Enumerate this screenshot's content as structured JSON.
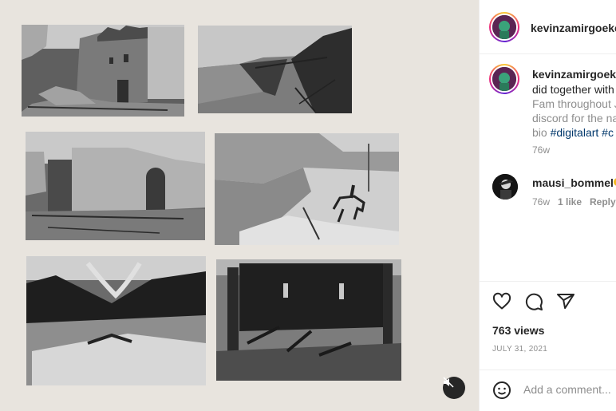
{
  "post": {
    "author": "kevinzamirgoeke",
    "caption_lines": [
      "did together with",
      "Fam throughout J",
      "discord for the na"
    ],
    "caption_last_prefix": "bio ",
    "hashtags": [
      "#digitalart",
      "#c"
    ],
    "caption_age": "76w"
  },
  "comment": {
    "username": "mausi_bommel",
    "age": "76w",
    "likes": "1 like",
    "reply_label": "Reply"
  },
  "stats": {
    "views": "763 views",
    "date": "JULY 31, 2021"
  },
  "composer": {
    "placeholder": "Add a comment..."
  },
  "icons": {
    "like": "heart-icon",
    "comment": "comment-icon",
    "share": "paper-plane-icon",
    "emoji": "emoji-icon",
    "mute": "speaker-muted-icon"
  },
  "colors": {
    "media_background": "#e8e4de",
    "hashtag": "#00376b",
    "muted_text": "#8e8e8e"
  }
}
